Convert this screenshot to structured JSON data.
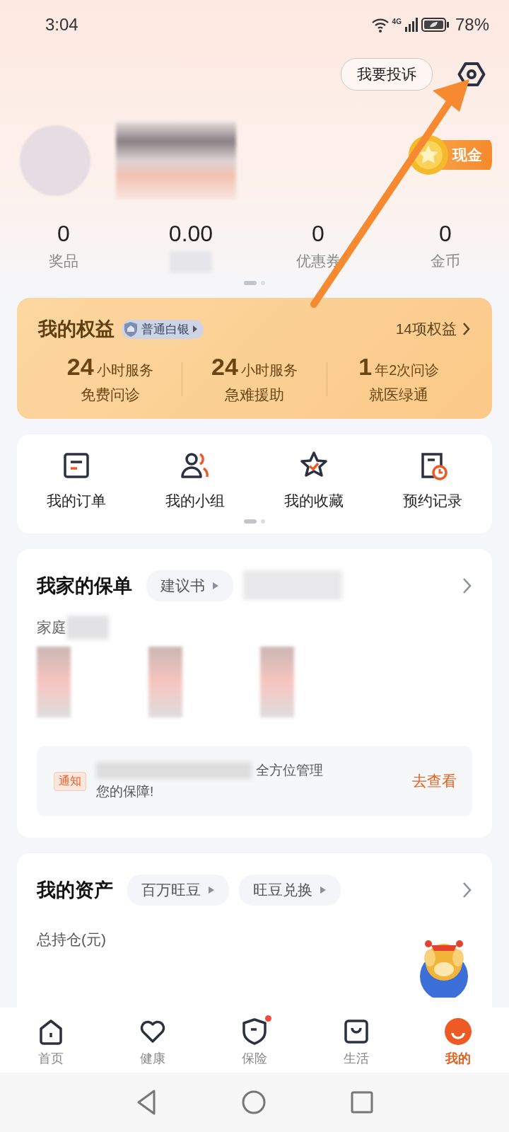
{
  "status_bar": {
    "time": "3:04",
    "network": "4G",
    "battery": "78%"
  },
  "header": {
    "complaint_button": "我要投诉",
    "cash_badge": "现金"
  },
  "stats": [
    {
      "value": "0",
      "label": "奖品"
    },
    {
      "value": "0.00"
    },
    {
      "value": "0",
      "label": "优惠券"
    },
    {
      "value": "0",
      "label": "金币"
    }
  ],
  "stats_pages": [
    {
      "selected": true
    },
    {
      "selected": false
    }
  ],
  "benefits": {
    "title": "我的权益",
    "tier": "普通白银",
    "link": "14项权益",
    "items": [
      {
        "number": "24",
        "unit": "小时服务",
        "label": "免费问诊"
      },
      {
        "number": "24",
        "unit": "小时服务",
        "label": "急难援助"
      },
      {
        "number": "1",
        "unit": "年2次问诊",
        "label": "就医绿通"
      }
    ]
  },
  "shortcuts": [
    {
      "kind": "order",
      "label": "我的订单"
    },
    {
      "kind": "group",
      "label": "我的小组"
    },
    {
      "kind": "favorite",
      "label": "我的收藏"
    },
    {
      "kind": "appointment",
      "label": "预约记录"
    }
  ],
  "shortcut_pages": [
    {
      "selected": true
    },
    {
      "selected": false
    }
  ],
  "policies": {
    "title": "我家的保单",
    "chips": [
      "建议书"
    ],
    "subtitle": "家庭",
    "notice": {
      "tag": "通知",
      "text_line_1": "全方位管理",
      "text_line_2": "您的保障!",
      "action": "去查看"
    }
  },
  "assets": {
    "title": "我的资产",
    "chips": [
      "百万旺豆",
      "旺豆兑换"
    ],
    "label": "总持仓(元)"
  },
  "tab_bar": [
    {
      "kind": "home",
      "label": "首页",
      "selected": false,
      "dot": false
    },
    {
      "kind": "heart",
      "label": "健康",
      "selected": false,
      "dot": false
    },
    {
      "kind": "shield",
      "label": "保险",
      "selected": false,
      "dot": true
    },
    {
      "kind": "bag",
      "label": "生活",
      "selected": false,
      "dot": false
    },
    {
      "kind": "me",
      "label": "我的",
      "selected": true,
      "dot": false
    }
  ]
}
